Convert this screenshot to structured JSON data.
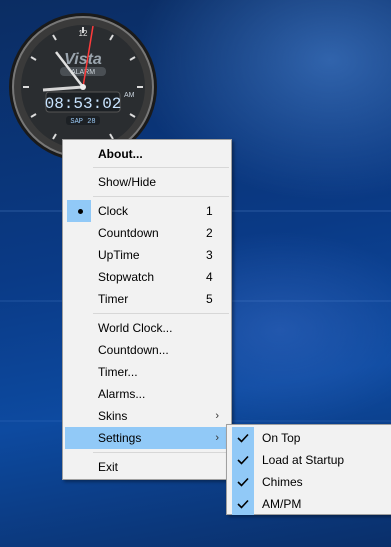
{
  "clock": {
    "brand": "Vista",
    "mode": "ALARM",
    "time": "08:53:02",
    "ampm": "AM",
    "date": "SAP 28",
    "numeral_12": "12",
    "numeral_6": "6"
  },
  "menu": {
    "about": "About...",
    "show_hide": "Show/Hide",
    "modes": [
      {
        "label": "Clock",
        "shortcut": "1",
        "selected": true
      },
      {
        "label": "Countdown",
        "shortcut": "2",
        "selected": false
      },
      {
        "label": "UpTime",
        "shortcut": "3",
        "selected": false
      },
      {
        "label": "Stopwatch",
        "shortcut": "4",
        "selected": false
      },
      {
        "label": "Timer",
        "shortcut": "5",
        "selected": false
      }
    ],
    "world_clock": "World Clock...",
    "countdown_dialog": "Countdown...",
    "timer_dialog": "Timer...",
    "alarms": "Alarms...",
    "skins": "Skins",
    "settings": "Settings",
    "exit": "Exit",
    "submenu_arrow": "›"
  },
  "settings_submenu": [
    {
      "label": "On Top",
      "checked": true
    },
    {
      "label": "Load at Startup",
      "checked": true
    },
    {
      "label": "Chimes",
      "checked": true
    },
    {
      "label": "AM/PM",
      "checked": true
    }
  ],
  "colors": {
    "highlight": "#91c9f7",
    "menu_bg": "#f2f2f2",
    "desktop": "#0a3a86"
  }
}
